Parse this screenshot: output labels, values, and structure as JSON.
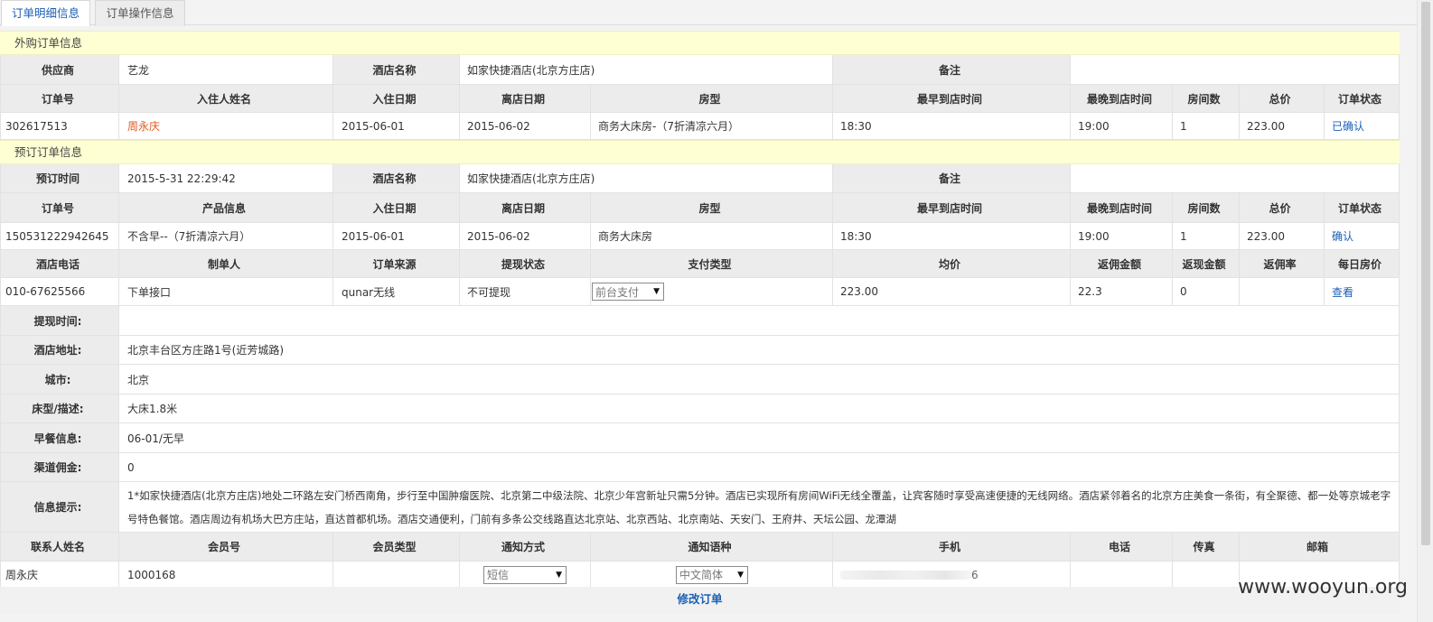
{
  "tabs": [
    "订单明细信息",
    "订单操作信息"
  ],
  "purchase": {
    "section_title": "外购订单信息",
    "row1": {
      "supplier_label": "供应商",
      "supplier": "艺龙",
      "hotel_label": "酒店名称",
      "hotel": "如家快捷酒店(北京方庄店)",
      "remark_label": "备注",
      "remark": ""
    },
    "headers": [
      "订单号",
      "入住人姓名",
      "入住日期",
      "离店日期",
      "房型",
      "最早到店时间",
      "最晚到店时间",
      "房间数",
      "总价",
      "订单状态"
    ],
    "values": [
      "302617513",
      "周永庆",
      "2015-06-01",
      "2015-06-02",
      "商务大床房-（7折清凉六月）",
      "18:30",
      "19:00",
      "1",
      "223.00",
      "已确认"
    ]
  },
  "booking": {
    "section_title": "预订订单信息",
    "row1": {
      "time_label": "预订时间",
      "time": "2015-5-31 22:29:42",
      "hotel_label": "酒店名称",
      "hotel": "如家快捷酒店(北京方庄店)",
      "remark_label": "备注",
      "remark": ""
    },
    "headers": [
      "订单号",
      "产品信息",
      "入住日期",
      "离店日期",
      "房型",
      "最早到店时间",
      "最晚到店时间",
      "房间数",
      "总价",
      "订单状态"
    ],
    "values": [
      "150531222942645",
      "不含早--（7折清凉六月）",
      "2015-06-01",
      "2015-06-02",
      "商务大床房",
      "18:30",
      "19:00",
      "1",
      "223.00",
      "确认"
    ],
    "headers2": [
      "酒店电话",
      "制单人",
      "订单来源",
      "提现状态",
      "支付类型",
      "均价",
      "返佣金额",
      "返现金额",
      "返佣率",
      "每日房价"
    ],
    "values2": [
      "010-67625566",
      "下单接口",
      "qunar无线",
      "不可提现",
      "前台支付",
      "223.00",
      "22.3",
      "0",
      "",
      "查看"
    ]
  },
  "details": [
    {
      "label": "提现时间:",
      "value": ""
    },
    {
      "label": "酒店地址:",
      "value": "北京丰台区方庄路1号(近芳城路)"
    },
    {
      "label": "城市:",
      "value": "北京"
    },
    {
      "label": "床型/描述:",
      "value": "大床1.8米"
    },
    {
      "label": "早餐信息:",
      "value": "06-01/无早"
    },
    {
      "label": "渠道佣金:",
      "value": "0"
    }
  ],
  "info": {
    "label": "信息提示:",
    "value": "1*如家快捷酒店(北京方庄店)地处二环路左安门桥西南角，步行至中国肿瘤医院、北京第二中级法院、北京少年宫新址只需5分钟。酒店已实现所有房间WiFi无线全覆盖，让宾客随时享受高速便捷的无线网络。酒店紧邻着名的北京方庄美食一条街，有全聚德、都一处等京城老字号特色餐馆。酒店周边有机场大巴方庄站，直达首都机场。酒店交通便利，门前有多条公交线路直达北京站、北京西站、北京南站、天安门、王府井、天坛公园、龙潭湖"
  },
  "contact": {
    "headers": [
      "联系人姓名",
      "会员号",
      "会员类型",
      "通知方式",
      "通知语种",
      "手机",
      "电话",
      "传真",
      "邮箱"
    ],
    "name": "周永庆",
    "member_no": "1000168",
    "member_type": "",
    "notify_method": "短信",
    "notify_lang": "中文简体",
    "phone_tail": "6",
    "tel": "",
    "fax": "",
    "email": ""
  },
  "modify_link": "修改订单",
  "watermark": "www.wooyun.org"
}
